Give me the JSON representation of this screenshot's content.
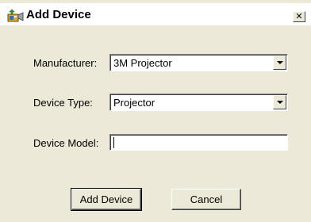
{
  "window": {
    "title": "Add Device",
    "close_glyph": "✕",
    "icon": "add-device-icon"
  },
  "form": {
    "manufacturer": {
      "label": "Manufacturer:",
      "value": "3M Projector"
    },
    "device_type": {
      "label": "Device Type:",
      "value": "Projector"
    },
    "device_model": {
      "label": "Device Model:",
      "value": ""
    }
  },
  "buttons": {
    "add_label": "Add Device",
    "cancel_label": "Cancel"
  }
}
